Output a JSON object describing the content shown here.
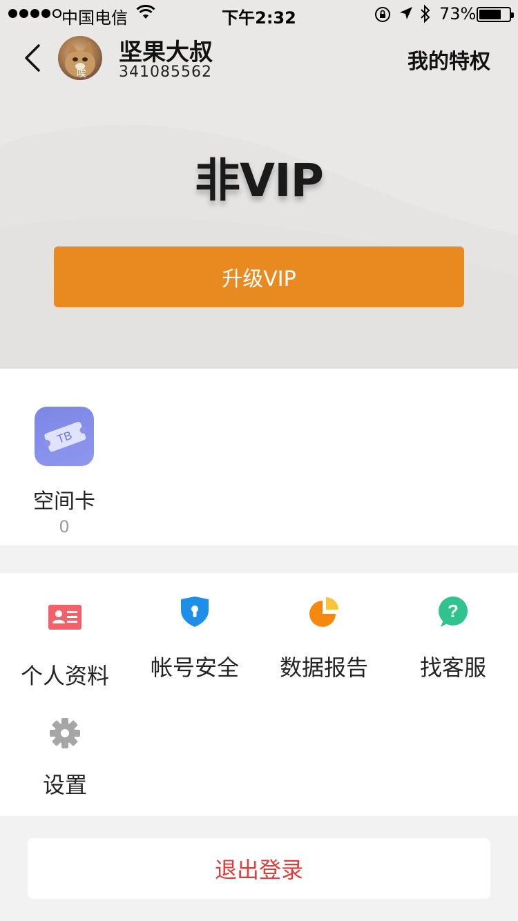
{
  "status_bar": {
    "carrier": "中国电信",
    "time": "下午2:32",
    "battery": "73%",
    "battery_level": 0.73
  },
  "header": {
    "back_icon": "chevron-left-icon",
    "avatar_tag": "唉",
    "user_name": "坚果大叔",
    "user_id": "341085562",
    "privilege_link": "我的特权"
  },
  "vip": {
    "status": "非VIP",
    "upgrade_label": "升级VIP",
    "accent_color": "#e98a20"
  },
  "card": {
    "icon_text": "TB",
    "label": "空间卡",
    "count": "0"
  },
  "menu": {
    "items": [
      {
        "label": "个人资料",
        "icon": "id-card-icon",
        "color": "#f2616a"
      },
      {
        "label": "帐号安全",
        "icon": "shield-lock-icon",
        "color": "#1e8fe8"
      },
      {
        "label": "数据报告",
        "icon": "pie-chart-icon",
        "color": "#f5890f"
      },
      {
        "label": "找客服",
        "icon": "help-chat-icon",
        "color": "#2fc48f"
      },
      {
        "label": "设置",
        "icon": "gear-icon",
        "color": "#a6a6a6"
      }
    ]
  },
  "logout": {
    "label": "退出登录",
    "color": "#e23b3b"
  }
}
